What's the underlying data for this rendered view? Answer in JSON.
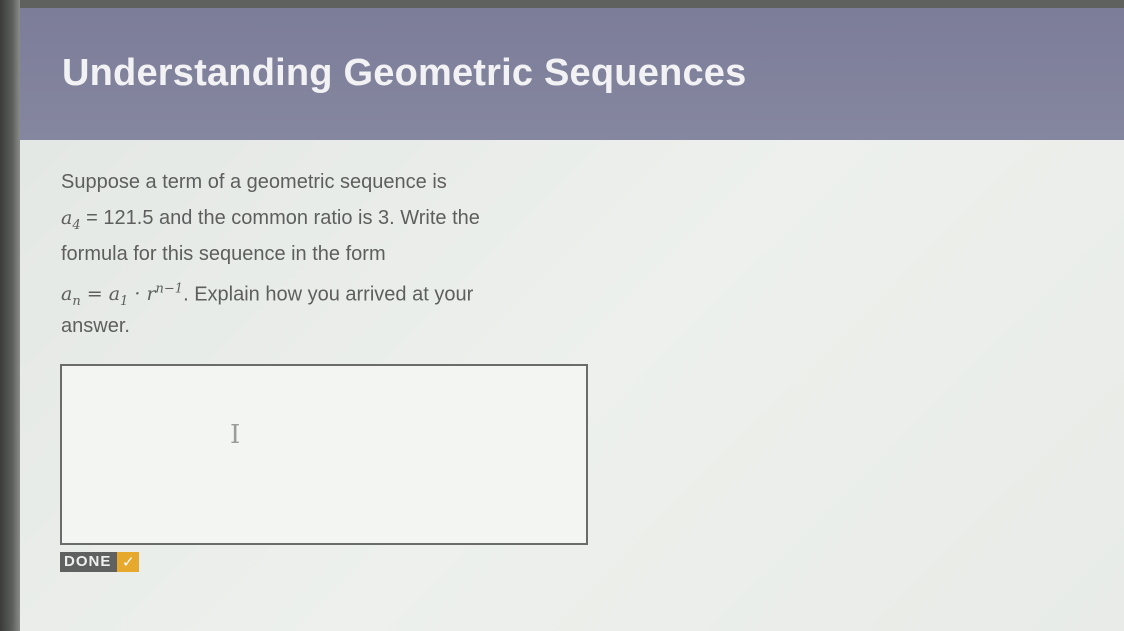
{
  "header": {
    "title": "Understanding Geometric Sequences"
  },
  "question": {
    "line1": "Suppose a term of a geometric sequence is",
    "a4_base": "a",
    "a4_sub": "4",
    "a4_value": " = 121.5",
    "line2_rest": " and the common ratio is 3. Write the",
    "line3": "formula for this sequence in the form",
    "formula_an_base": "a",
    "formula_an_sub": "n",
    "formula_eq": " = ",
    "formula_a1_base": "a",
    "formula_a1_sub": "1",
    "formula_dot": " · ",
    "formula_r": "r",
    "formula_exp": "n−1",
    "line4_rest": ". Explain how you arrived at your",
    "line5": "answer."
  },
  "answer": {
    "value": "",
    "cursor_icon": "text-cursor-icon"
  },
  "done_button": {
    "label": "DONE",
    "icon": "check-icon",
    "accent_color": "#e7a92d"
  },
  "colors": {
    "header_bg": "#7f809b",
    "content_bg": "#e9ece8",
    "text": "#5d5f5e"
  }
}
